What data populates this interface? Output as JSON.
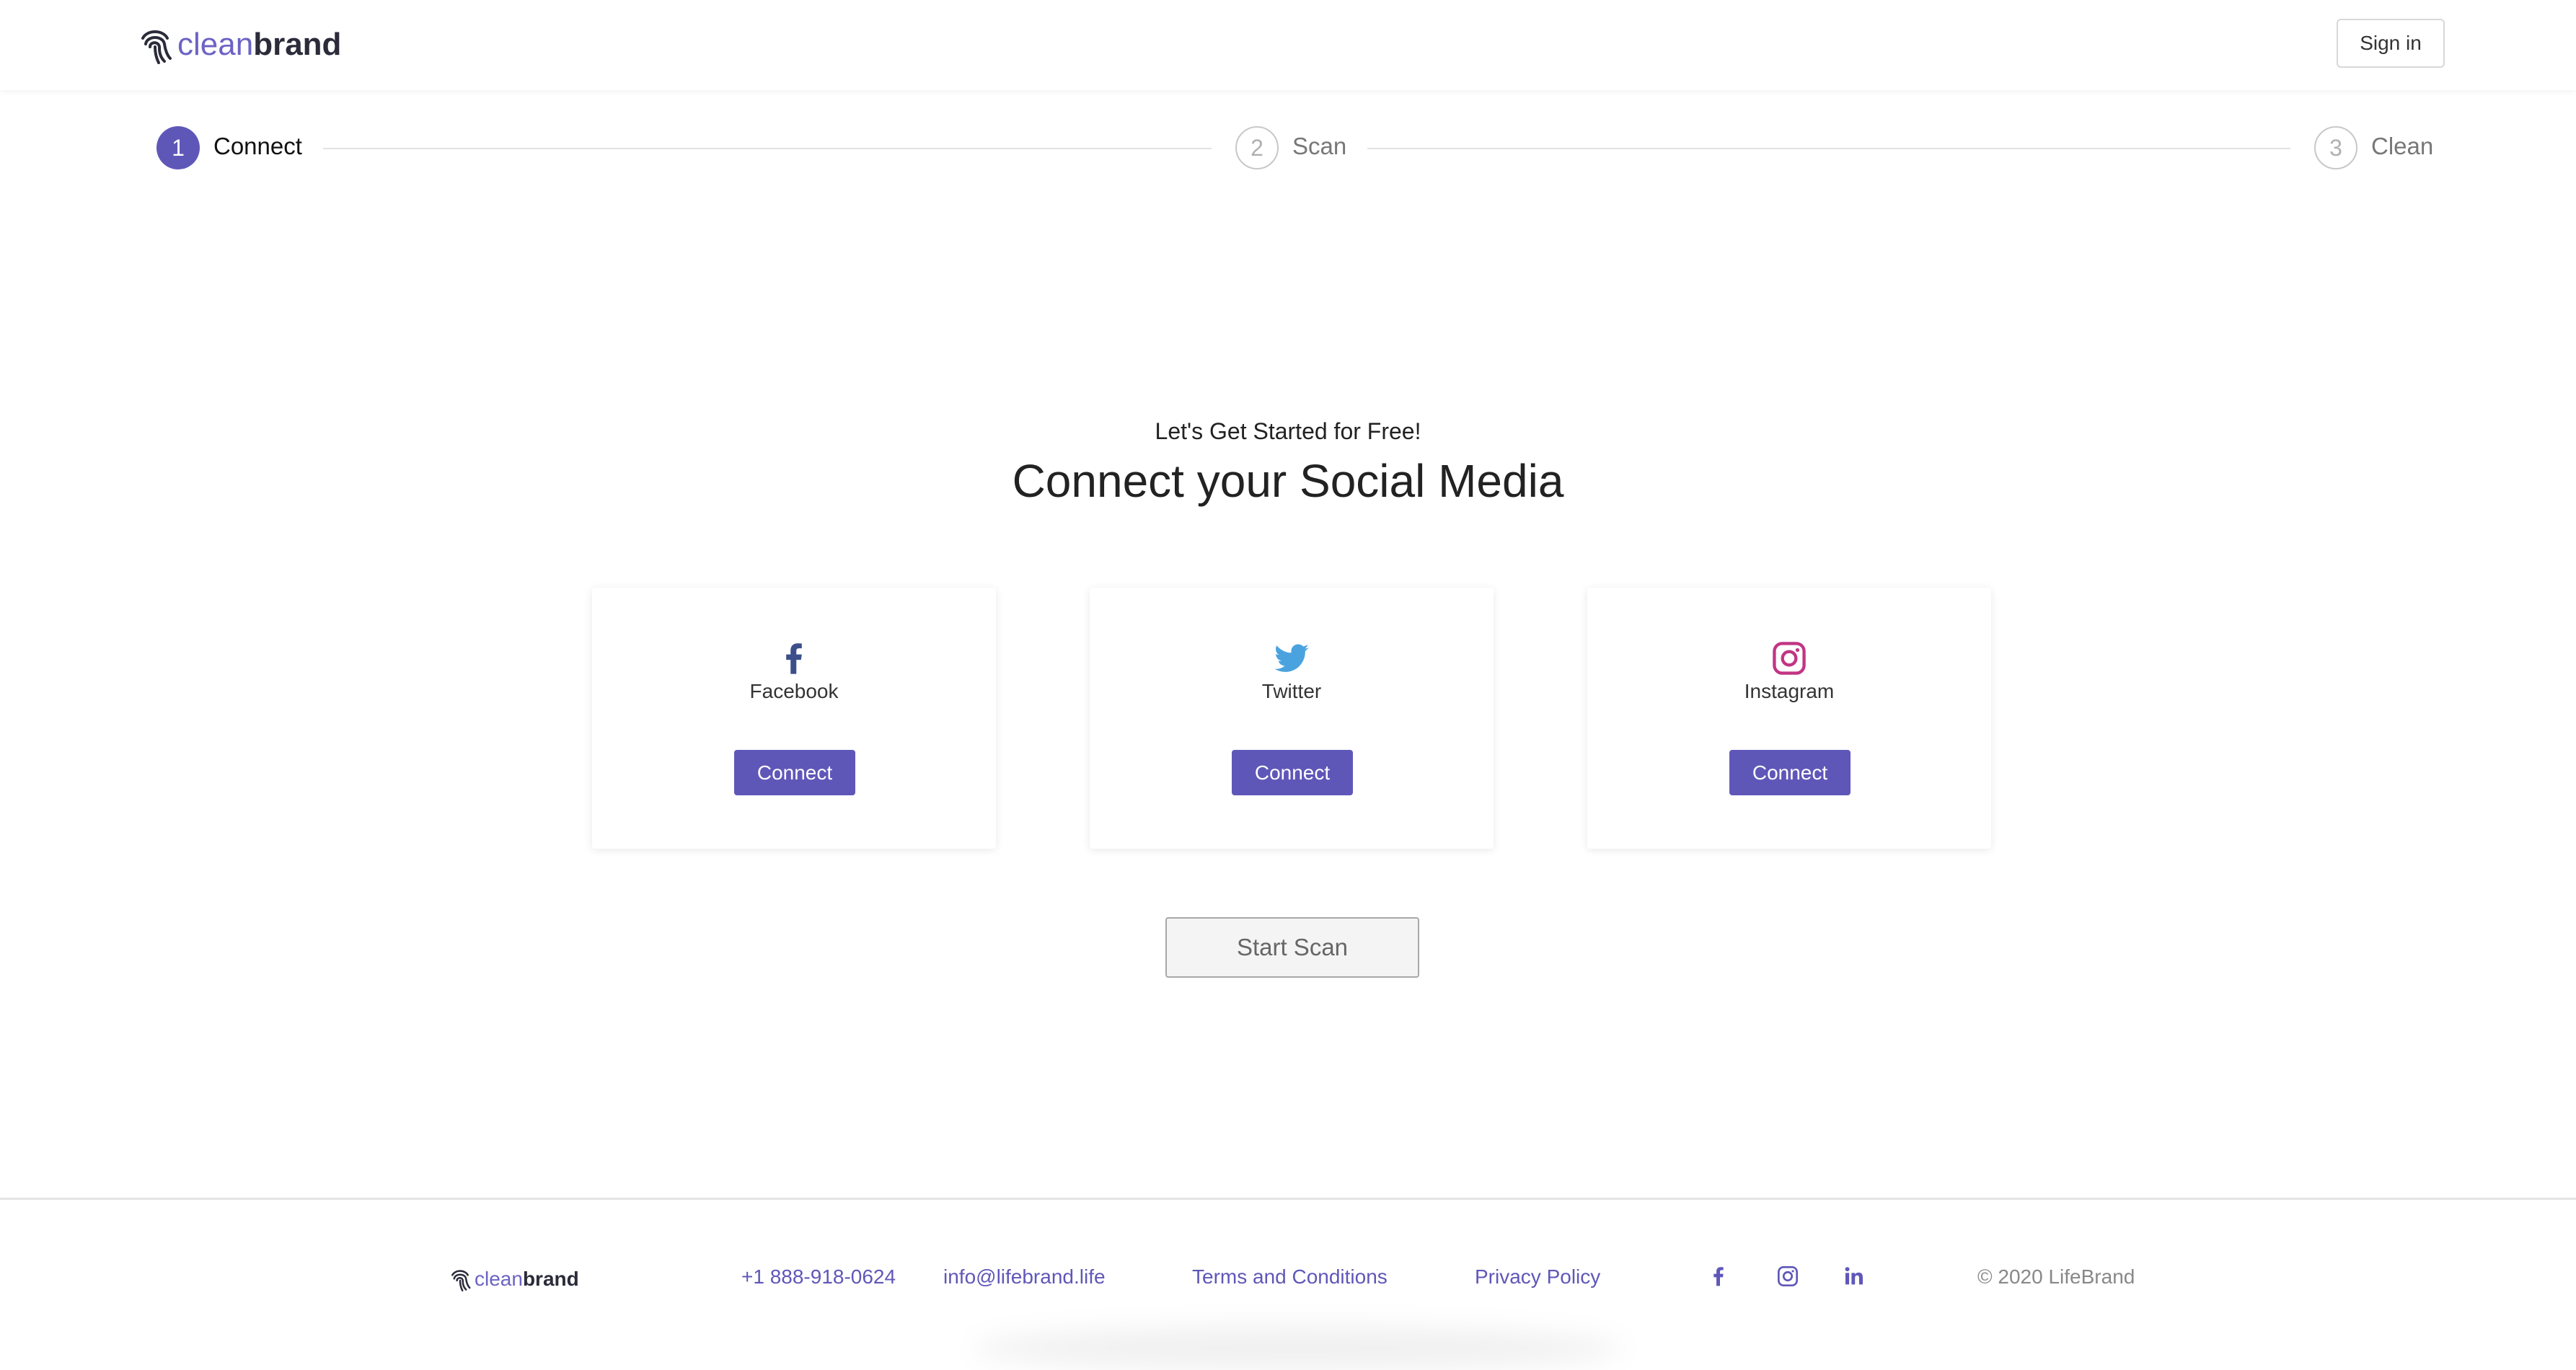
{
  "brand": {
    "part1": "clean",
    "part2": "brand"
  },
  "header": {
    "signin_label": "Sign in"
  },
  "steps": [
    {
      "number": "1",
      "label": "Connect",
      "state": "active"
    },
    {
      "number": "2",
      "label": "Scan",
      "state": "inactive"
    },
    {
      "number": "3",
      "label": "Clean",
      "state": "inactive"
    }
  ],
  "main": {
    "subtitle": "Let's Get Started for Free!",
    "title": "Connect your Social Media",
    "cards": [
      {
        "name": "Facebook",
        "icon": "facebook-icon",
        "button": "Connect"
      },
      {
        "name": "Twitter",
        "icon": "twitter-icon",
        "button": "Connect"
      },
      {
        "name": "Instagram",
        "icon": "instagram-icon",
        "button": "Connect"
      }
    ],
    "start_scan_label": "Start Scan"
  },
  "footer": {
    "phone": "+1 888-918-0624",
    "email": "info@lifebrand.life",
    "terms": "Terms and Conditions",
    "privacy": "Privacy Policy",
    "social_icons": [
      "facebook-icon",
      "instagram-icon",
      "linkedin-icon"
    ],
    "copyright": "© 2020 LifeBrand"
  },
  "colors": {
    "accent": "#5f57b8",
    "brand_light": "#6b63c4",
    "brand_dark": "#2b2b3a",
    "facebook": "#3b4f8a",
    "twitter": "#4aa3df",
    "instagram": "#c13584"
  }
}
